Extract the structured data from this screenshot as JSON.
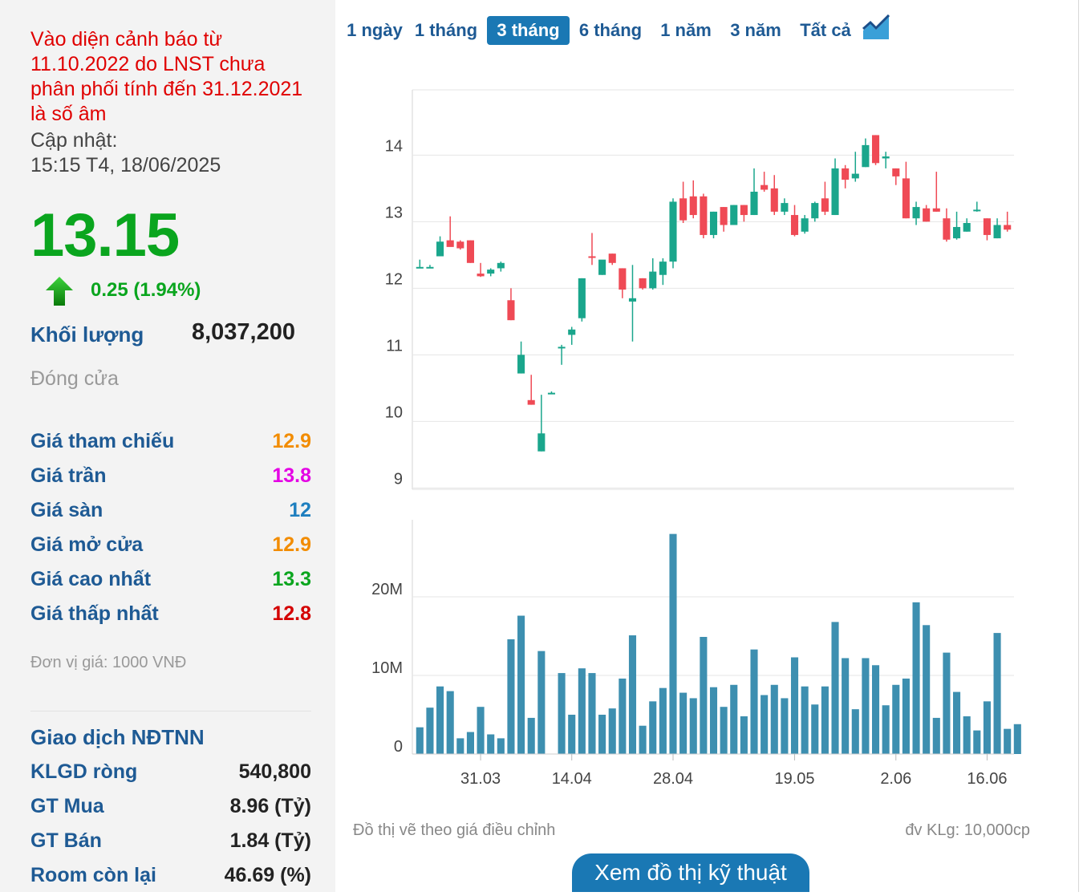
{
  "sidebar": {
    "warning": "Vào diện cảnh báo từ 11.10.2022 do LNST chưa phân phối tính đến 31.12.2021 là số âm",
    "update_label": "Cập nhật:",
    "update_time": "15:15 T4, 18/06/2025",
    "price": "13.15",
    "change": "0.25 (1.94%)",
    "volume_label": "Khối lượng",
    "volume_value": "8,037,200",
    "status": "Đóng cửa",
    "stats": [
      {
        "label": "Giá tham chiếu",
        "value": "12.9",
        "color": "#f28c00"
      },
      {
        "label": "Giá trần",
        "value": "13.8",
        "color": "#e400e4"
      },
      {
        "label": "Giá sàn",
        "value": "12",
        "color": "#1e7fbf"
      },
      {
        "label": "Giá mở cửa",
        "value": "12.9",
        "color": "#f28c00"
      },
      {
        "label": "Giá cao nhất",
        "value": "13.3",
        "color": "#0aa51e"
      },
      {
        "label": "Giá thấp nhất",
        "value": "12.8",
        "color": "#d40000"
      }
    ],
    "unit_note": "Đơn vị giá: 1000 VNĐ",
    "foreign_title": "Giao dịch NĐTNN",
    "foreign": [
      {
        "label": "KLGD ròng",
        "value": "540,800"
      },
      {
        "label": "GT Mua",
        "value": "8.96 (Tỷ)"
      },
      {
        "label": "GT Bán",
        "value": "1.84 (Tỷ)"
      },
      {
        "label": "Room còn lại",
        "value": "46.69 (%)"
      }
    ]
  },
  "tabs": [
    "1 ngày",
    "1 tháng",
    "3 tháng",
    "6 tháng",
    "1 năm",
    "3 năm",
    "Tất cả"
  ],
  "active_tab": "3 tháng",
  "footer": {
    "left_note": "Đồ thị vẽ theo giá điều chỉnh",
    "right_note": "đv KLg: 10,000cp",
    "button": "Xem đồ thị kỹ thuật"
  },
  "colors": {
    "up": "#1aa68c",
    "down": "#ef4a55",
    "volume": "#3d8fb0",
    "brand": "#1a78b4"
  },
  "chart_data": [
    {
      "type": "candlestick",
      "title": "",
      "y_ticks": [
        9,
        10,
        11,
        12,
        13,
        14
      ],
      "ylim": [
        8.98,
        14.98
      ],
      "x_ticks": [
        "31.03",
        "14.04",
        "28.04",
        "19.05",
        "2.06",
        "16.06"
      ],
      "x_tick_index": [
        6,
        15,
        25,
        37,
        47,
        56
      ],
      "grid": true,
      "candles": [
        {
          "o": 12.32,
          "h": 12.43,
          "l": 12.3,
          "c": 12.32
        },
        {
          "o": 12.32,
          "h": 12.35,
          "l": 12.3,
          "c": 12.32
        },
        {
          "o": 12.48,
          "h": 12.78,
          "l": 12.48,
          "c": 12.7
        },
        {
          "o": 12.72,
          "h": 13.08,
          "l": 12.63,
          "c": 12.62
        },
        {
          "o": 12.7,
          "h": 12.72,
          "l": 12.58,
          "c": 12.6
        },
        {
          "o": 12.72,
          "h": 12.72,
          "l": 12.38,
          "c": 12.38
        },
        {
          "o": 12.22,
          "h": 12.38,
          "l": 12.17,
          "c": 12.18
        },
        {
          "o": 12.22,
          "h": 12.3,
          "l": 12.18,
          "c": 12.28
        },
        {
          "o": 12.3,
          "h": 12.4,
          "l": 12.25,
          "c": 12.38
        },
        {
          "o": 11.82,
          "h": 12.0,
          "l": 11.52,
          "c": 11.52
        },
        {
          "o": 10.72,
          "h": 11.2,
          "l": 10.72,
          "c": 11.0
        },
        {
          "o": 10.32,
          "h": 10.7,
          "l": 10.25,
          "c": 10.25
        },
        {
          "o": 9.55,
          "h": 10.4,
          "l": 9.55,
          "c": 9.82
        },
        {
          "o": 10.43,
          "h": 10.45,
          "l": 10.42,
          "c": 10.43
        },
        {
          "o": 11.12,
          "h": 11.15,
          "l": 10.85,
          "c": 11.12
        },
        {
          "o": 11.3,
          "h": 11.42,
          "l": 11.15,
          "c": 11.38
        },
        {
          "o": 11.55,
          "h": 12.15,
          "l": 11.5,
          "c": 12.15
        },
        {
          "o": 12.48,
          "h": 12.83,
          "l": 12.35,
          "c": 12.46
        },
        {
          "o": 12.2,
          "h": 12.4,
          "l": 12.2,
          "c": 12.43
        },
        {
          "o": 12.52,
          "h": 12.52,
          "l": 12.35,
          "c": 12.38
        },
        {
          "o": 12.3,
          "h": 12.3,
          "l": 11.85,
          "c": 11.98
        },
        {
          "o": 11.8,
          "h": 12.35,
          "l": 11.2,
          "c": 11.85
        },
        {
          "o": 12.15,
          "h": 12.15,
          "l": 11.98,
          "c": 12.0
        },
        {
          "o": 12.0,
          "h": 12.45,
          "l": 11.98,
          "c": 12.25
        },
        {
          "o": 12.2,
          "h": 12.45,
          "l": 12.05,
          "c": 12.4
        },
        {
          "o": 12.4,
          "h": 13.35,
          "l": 12.3,
          "c": 13.3
        },
        {
          "o": 13.35,
          "h": 13.6,
          "l": 12.98,
          "c": 13.02
        },
        {
          "o": 13.38,
          "h": 13.62,
          "l": 13.05,
          "c": 13.1
        },
        {
          "o": 13.38,
          "h": 13.42,
          "l": 12.75,
          "c": 12.8
        },
        {
          "o": 12.8,
          "h": 13.15,
          "l": 12.75,
          "c": 13.15
        },
        {
          "o": 13.22,
          "h": 13.22,
          "l": 12.85,
          "c": 12.95
        },
        {
          "o": 12.95,
          "h": 13.25,
          "l": 12.95,
          "c": 13.25
        },
        {
          "o": 13.25,
          "h": 13.25,
          "l": 13.0,
          "c": 13.1
        },
        {
          "o": 13.1,
          "h": 13.8,
          "l": 13.1,
          "c": 13.45
        },
        {
          "o": 13.55,
          "h": 13.75,
          "l": 13.45,
          "c": 13.48
        },
        {
          "o": 13.5,
          "h": 13.7,
          "l": 13.1,
          "c": 13.15
        },
        {
          "o": 13.15,
          "h": 13.35,
          "l": 13.1,
          "c": 13.28
        },
        {
          "o": 13.1,
          "h": 13.25,
          "l": 12.78,
          "c": 12.8
        },
        {
          "o": 12.85,
          "h": 13.1,
          "l": 12.82,
          "c": 13.05
        },
        {
          "o": 13.05,
          "h": 13.3,
          "l": 13.0,
          "c": 13.28
        },
        {
          "o": 13.35,
          "h": 13.6,
          "l": 13.1,
          "c": 13.15
        },
        {
          "o": 13.1,
          "h": 13.95,
          "l": 13.1,
          "c": 13.8
        },
        {
          "o": 13.8,
          "h": 13.85,
          "l": 13.5,
          "c": 13.63
        },
        {
          "o": 13.65,
          "h": 14.05,
          "l": 13.6,
          "c": 13.72
        },
        {
          "o": 13.82,
          "h": 14.25,
          "l": 13.82,
          "c": 14.15
        },
        {
          "o": 14.3,
          "h": 14.3,
          "l": 13.85,
          "c": 13.88
        },
        {
          "o": 13.95,
          "h": 14.05,
          "l": 13.8,
          "c": 13.98
        },
        {
          "o": 13.8,
          "h": 13.8,
          "l": 13.55,
          "c": 13.68
        },
        {
          "o": 13.65,
          "h": 13.9,
          "l": 13.05,
          "c": 13.05
        },
        {
          "o": 13.05,
          "h": 13.3,
          "l": 12.95,
          "c": 13.22
        },
        {
          "o": 13.2,
          "h": 13.25,
          "l": 13.0,
          "c": 13.0
        },
        {
          "o": 13.2,
          "h": 13.75,
          "l": 13.15,
          "c": 13.15
        },
        {
          "o": 13.05,
          "h": 13.2,
          "l": 12.7,
          "c": 12.73
        },
        {
          "o": 12.75,
          "h": 13.15,
          "l": 12.73,
          "c": 12.92
        },
        {
          "o": 12.85,
          "h": 13.05,
          "l": 12.85,
          "c": 12.98
        },
        {
          "o": 13.18,
          "h": 13.3,
          "l": 13.15,
          "c": 13.18
        },
        {
          "o": 13.05,
          "h": 13.05,
          "l": 12.72,
          "c": 12.8
        },
        {
          "o": 12.75,
          "h": 13.05,
          "l": 12.75,
          "c": 12.95
        },
        {
          "o": 12.95,
          "h": 13.15,
          "l": 12.85,
          "c": 12.88
        }
      ]
    },
    {
      "type": "bar",
      "title": "",
      "y_ticks": [
        "0",
        "10M",
        "20M"
      ],
      "y_tick_values": [
        0,
        10,
        20
      ],
      "ylim": [
        0,
        29.8
      ],
      "unit": "M",
      "values": [
        3.4,
        5.9,
        8.6,
        8.0,
        2.0,
        2.8,
        6.0,
        2.5,
        2.0,
        14.6,
        17.6,
        4.6,
        13.1,
        0,
        10.3,
        5.0,
        10.9,
        10.3,
        5.0,
        5.8,
        9.6,
        15.1,
        3.6,
        6.7,
        8.4,
        28.0,
        7.8,
        7.1,
        14.9,
        8.5,
        6.0,
        8.8,
        4.8,
        13.3,
        7.5,
        8.8,
        7.1,
        12.3,
        8.6,
        6.3,
        8.6,
        16.8,
        12.2,
        5.7,
        12.2,
        11.3,
        6.2,
        8.8,
        9.6,
        19.3,
        16.4,
        4.6,
        12.9,
        7.9,
        4.8,
        3.0,
        6.7,
        15.4,
        3.2,
        3.8
      ]
    }
  ]
}
